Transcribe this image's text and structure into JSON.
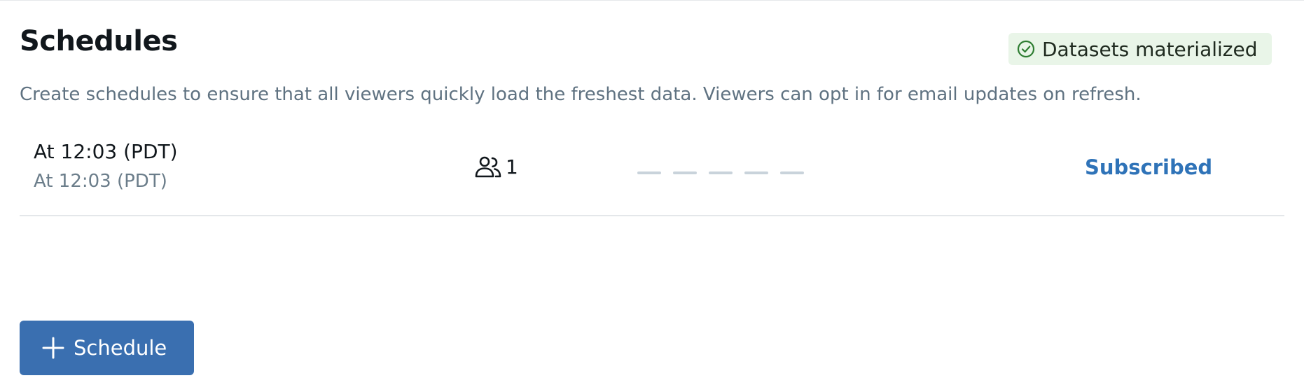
{
  "header": {
    "title": "Schedules",
    "status_badge": {
      "label": "Datasets materialized",
      "icon": "check-circle-icon",
      "color": "#e9f5e8"
    }
  },
  "description": "Create schedules to ensure that all viewers quickly load the freshest data. Viewers can opt in for email updates on refresh.",
  "schedules": [
    {
      "title": "At 12:03 (PDT)",
      "subtitle": "At 12:03 (PDT)",
      "subscriber_icon": "people-icon",
      "subscriber_count": "1",
      "history": [
        "none",
        "none",
        "none",
        "none",
        "none"
      ],
      "action_label": "Subscribed"
    }
  ],
  "add_button": {
    "icon": "plus-icon",
    "label": "Schedule"
  },
  "colors": {
    "accent": "#2f73b8",
    "button": "#3a6fb0",
    "muted_text": "#5f7281",
    "history_dash": "#c9d3db"
  }
}
